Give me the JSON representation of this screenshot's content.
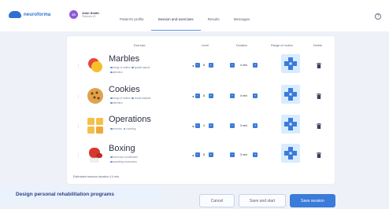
{
  "logo": {
    "text": "neuroforma"
  },
  "user": {
    "initials": "JS",
    "name": "John Smith",
    "id": "Patients ID"
  },
  "tabs": [
    {
      "label": "Patient's profile"
    },
    {
      "label": "Session and exercises"
    },
    {
      "label": "Results"
    },
    {
      "label": "Messages"
    }
  ],
  "table": {
    "headers": {
      "exercise": "Exercise",
      "level": "Level",
      "duration": "Duration",
      "rom": "Range of motion",
      "delete": "Delete"
    }
  },
  "exercises": [
    {
      "name": "Marbles",
      "tags_line1": [
        "range of motion",
        "spatial aspect"
      ],
      "tags_line2": [
        "attention"
      ],
      "level": "8",
      "duration": "4 min"
    },
    {
      "name": "Cookies",
      "tags_line1": [
        "range of motion",
        "visual analysis"
      ],
      "tags_line2": [
        "attention"
      ],
      "level": "8",
      "duration": "4 min"
    },
    {
      "name": "Operations",
      "tags_line1": [
        "memory",
        "counting"
      ],
      "tags_line2": [],
      "level": "4",
      "duration": "3 min"
    },
    {
      "name": "Boxing",
      "tags_line1": [
        "hand-eye coordination"
      ],
      "tags_line2": [
        "speeding movements"
      ],
      "level": "8",
      "duration": "3 min"
    }
  ],
  "estimate": "Estimated session duration 14 min.",
  "banner": "Design personal rehabilitation programs",
  "buttons": {
    "cancel": "Cancel",
    "save_start": "Save and start",
    "save": "Save session"
  },
  "colors": {
    "accent": "#3b7bd9",
    "brand": "#2f6fd0",
    "banner_text": "#2e3f86"
  }
}
